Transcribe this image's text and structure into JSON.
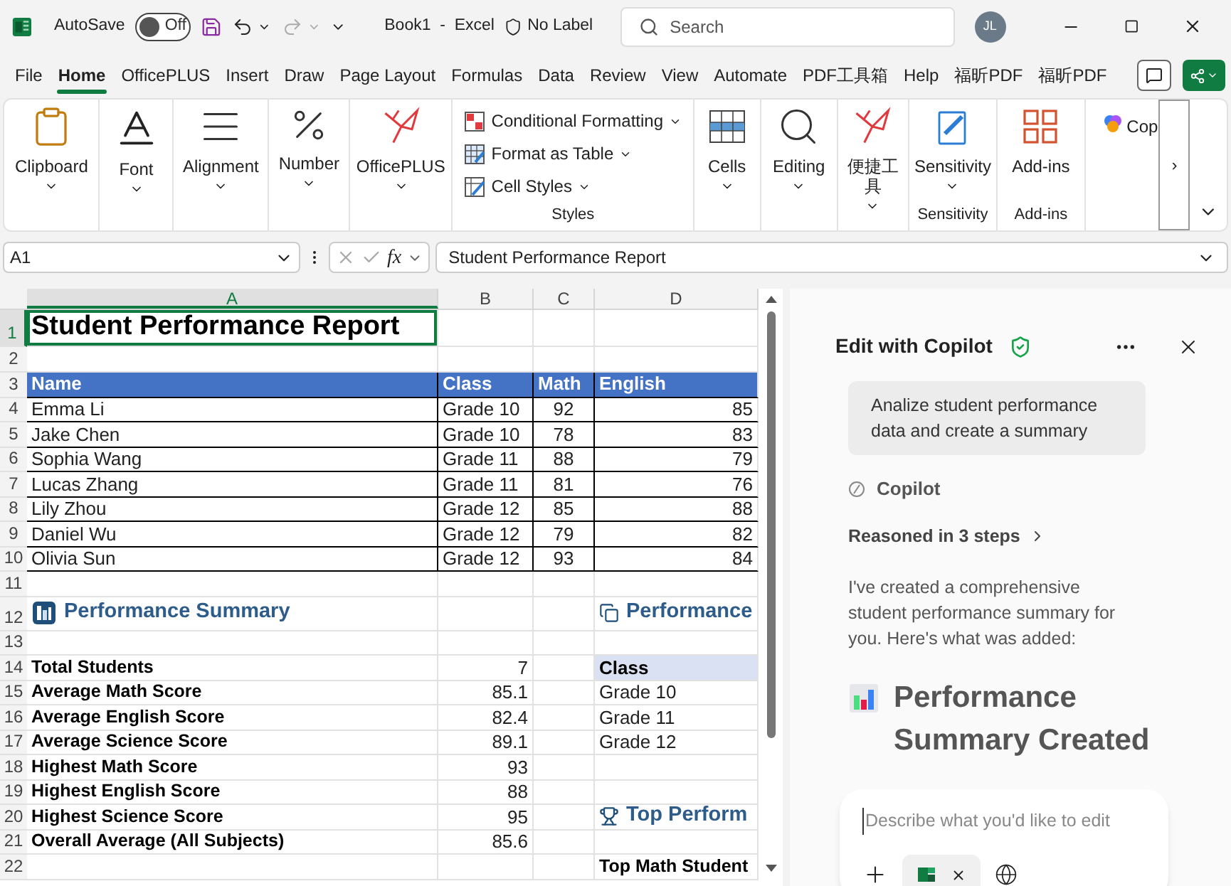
{
  "title_bar": {
    "autosave_label": "AutoSave",
    "autosave": {
      "on": false,
      "label": "Off"
    },
    "document": "Book1  -  Excel",
    "sensitivity": "No Label",
    "search": {
      "placeholder": "Search"
    },
    "avatar": "JL"
  },
  "tabs": [
    {
      "label": "File",
      "selected": false
    },
    {
      "label": "Home",
      "selected": true
    },
    {
      "label": "OfficePLUS",
      "selected": false
    },
    {
      "label": "Insert",
      "selected": false
    },
    {
      "label": "Draw",
      "selected": false
    },
    {
      "label": "Page Layout",
      "selected": false
    },
    {
      "label": "Formulas",
      "selected": false
    },
    {
      "label": "Data",
      "selected": false
    },
    {
      "label": "Review",
      "selected": false
    },
    {
      "label": "View",
      "selected": false
    },
    {
      "label": "Automate",
      "selected": false
    },
    {
      "label": "PDF工具箱",
      "selected": false
    },
    {
      "label": "Help",
      "selected": false
    },
    {
      "label": "福昕PDF",
      "selected": false
    },
    {
      "label": "福昕PDF",
      "selected": false
    }
  ],
  "ribbon": {
    "groups": [
      {
        "kind": "big",
        "label": "Clipboard",
        "dropdown": true
      },
      {
        "kind": "big",
        "label": "Font",
        "dropdown": true
      },
      {
        "kind": "big",
        "label": "Alignment",
        "dropdown": true
      },
      {
        "kind": "big",
        "label": "Number",
        "dropdown": true
      },
      {
        "kind": "big",
        "label": "OfficePLUS",
        "dropdown": true
      },
      {
        "kind": "list",
        "group_label": "Styles",
        "items": [
          {
            "label": "Conditional Formatting"
          },
          {
            "label": "Format as Table"
          },
          {
            "label": "Cell Styles"
          }
        ]
      },
      {
        "kind": "big",
        "label": "Cells",
        "dropdown": true
      },
      {
        "kind": "big",
        "label": "Editing",
        "dropdown": true
      },
      {
        "kind": "big",
        "label": "便捷工具",
        "dropdown": true
      },
      {
        "kind": "big",
        "label": "Sensitivity",
        "dropdown": true,
        "group_label": "Sensitivity"
      },
      {
        "kind": "big",
        "label": "Add-ins",
        "dropdown": false,
        "group_label": "Add-ins"
      },
      {
        "kind": "partial",
        "label": "Cop"
      }
    ],
    "more": "›"
  },
  "formula_bar": {
    "name_box": "A1",
    "fx": "fx",
    "formula": "Student Performance Report"
  },
  "sheet": {
    "columns": [
      {
        "label": "A",
        "selected": true
      },
      {
        "label": "B",
        "selected": false
      },
      {
        "label": "C",
        "selected": false
      },
      {
        "label": "D",
        "selected": false
      }
    ],
    "rows": [
      {
        "num": "1",
        "kind": "title",
        "selected": true,
        "cells": {
          "A": {
            "text": "Student Performance Report",
            "kind": "title"
          }
        }
      },
      {
        "num": "2",
        "kind": "blank",
        "selected": false,
        "cells": {}
      },
      {
        "num": "3",
        "kind": "header",
        "selected": false,
        "cells": {
          "A": {
            "text": "Name",
            "kind": "header"
          },
          "B": {
            "text": "Class",
            "kind": "header"
          },
          "C": {
            "text": "Math",
            "kind": "header"
          },
          "D": {
            "text": "English",
            "kind": "header"
          }
        }
      },
      {
        "num": "4",
        "kind": "table",
        "selected": false,
        "cells": {
          "A": {
            "text": "Emma Li",
            "kind": "text"
          },
          "B": {
            "text": "Grade 10",
            "kind": "text"
          },
          "C": {
            "text": "92",
            "kind": "score"
          },
          "D": {
            "text": "85",
            "kind": "number"
          }
        }
      },
      {
        "num": "5",
        "kind": "table",
        "selected": false,
        "cells": {
          "A": {
            "text": "Jake Chen",
            "kind": "text"
          },
          "B": {
            "text": "Grade 10",
            "kind": "text"
          },
          "C": {
            "text": "78",
            "kind": "score"
          },
          "D": {
            "text": "83",
            "kind": "number"
          }
        }
      },
      {
        "num": "6",
        "kind": "table",
        "selected": false,
        "cells": {
          "A": {
            "text": "Sophia Wang",
            "kind": "text"
          },
          "B": {
            "text": "Grade 11",
            "kind": "text"
          },
          "C": {
            "text": "88",
            "kind": "score"
          },
          "D": {
            "text": "79",
            "kind": "number"
          }
        }
      },
      {
        "num": "7",
        "kind": "table",
        "selected": false,
        "cells": {
          "A": {
            "text": "Lucas Zhang",
            "kind": "text"
          },
          "B": {
            "text": "Grade 11",
            "kind": "text"
          },
          "C": {
            "text": "81",
            "kind": "score"
          },
          "D": {
            "text": "76",
            "kind": "number"
          }
        }
      },
      {
        "num": "8",
        "kind": "table",
        "selected": false,
        "cells": {
          "A": {
            "text": "Lily Zhou",
            "kind": "text"
          },
          "B": {
            "text": "Grade 12",
            "kind": "text"
          },
          "C": {
            "text": "85",
            "kind": "score"
          },
          "D": {
            "text": "88",
            "kind": "number"
          }
        }
      },
      {
        "num": "9",
        "kind": "table",
        "selected": false,
        "cells": {
          "A": {
            "text": "Daniel Wu",
            "kind": "text"
          },
          "B": {
            "text": "Grade 12",
            "kind": "text"
          },
          "C": {
            "text": "79",
            "kind": "score"
          },
          "D": {
            "text": "82",
            "kind": "number"
          }
        }
      },
      {
        "num": "10",
        "kind": "table",
        "selected": false,
        "cells": {
          "A": {
            "text": "Olivia Sun",
            "kind": "text"
          },
          "B": {
            "text": "Grade 12",
            "kind": "text"
          },
          "C": {
            "text": "93",
            "kind": "score"
          },
          "D": {
            "text": "84",
            "kind": "number"
          }
        }
      },
      {
        "num": "11",
        "kind": "blank",
        "selected": false,
        "cells": {}
      },
      {
        "num": "12",
        "kind": "section",
        "selected": false,
        "cells": {
          "A": {
            "text": "Performance Summary",
            "kind": "heading"
          },
          "D": {
            "text": "Performance",
            "kind": "heading"
          }
        }
      },
      {
        "num": "13",
        "kind": "blank",
        "selected": false,
        "cells": {}
      },
      {
        "num": "14",
        "kind": "stat",
        "selected": false,
        "cells": {
          "A": {
            "text": "Total Students",
            "kind": "label"
          },
          "B": {
            "text": "7",
            "kind": "number"
          },
          "D": {
            "text": "Class",
            "kind": "subheader"
          }
        }
      },
      {
        "num": "15",
        "kind": "stat",
        "selected": false,
        "cells": {
          "A": {
            "text": "Average Math Score",
            "kind": "label"
          },
          "B": {
            "text": "85.1",
            "kind": "number"
          },
          "D": {
            "text": "Grade 10",
            "kind": "text"
          }
        }
      },
      {
        "num": "16",
        "kind": "stat",
        "selected": false,
        "cells": {
          "A": {
            "text": "Average English Score",
            "kind": "label"
          },
          "B": {
            "text": "82.4",
            "kind": "number"
          },
          "D": {
            "text": "Grade 11",
            "kind": "text"
          }
        }
      },
      {
        "num": "17",
        "kind": "stat",
        "selected": false,
        "cells": {
          "A": {
            "text": "Average Science Score",
            "kind": "label"
          },
          "B": {
            "text": "89.1",
            "kind": "number"
          },
          "D": {
            "text": "Grade 12",
            "kind": "text"
          }
        }
      },
      {
        "num": "18",
        "kind": "stat",
        "selected": false,
        "cells": {
          "A": {
            "text": "Highest Math Score",
            "kind": "label"
          },
          "B": {
            "text": "93",
            "kind": "number"
          }
        }
      },
      {
        "num": "19",
        "kind": "stat",
        "selected": false,
        "cells": {
          "A": {
            "text": "Highest English Score",
            "kind": "label"
          },
          "B": {
            "text": "88",
            "kind": "number"
          }
        }
      },
      {
        "num": "20",
        "kind": "stat",
        "selected": false,
        "cells": {
          "A": {
            "text": "Highest Science Score",
            "kind": "label"
          },
          "B": {
            "text": "95",
            "kind": "number"
          },
          "D": {
            "text": "Top Perform",
            "kind": "heading"
          }
        }
      },
      {
        "num": "21",
        "kind": "stat",
        "selected": false,
        "cells": {
          "A": {
            "text": "Overall Average (All Subjects)",
            "kind": "label"
          },
          "B": {
            "text": "85.6",
            "kind": "number"
          }
        }
      },
      {
        "num": "22",
        "kind": "stat",
        "selected": false,
        "cells": {
          "D": {
            "text": "Top Math Student",
            "kind": "label"
          }
        }
      }
    ]
  },
  "copilot": {
    "title": "Edit with Copilot",
    "prompt": "Analize student performance data and create a summary",
    "assistant": "Copilot",
    "reasoning": "Reasoned in 3 steps",
    "message": "I've created a comprehensive student performance summary for you. Here's what was added:",
    "heading": "Performance Summary Created",
    "input": {
      "placeholder": "Describe what you'd like to edit"
    }
  }
}
